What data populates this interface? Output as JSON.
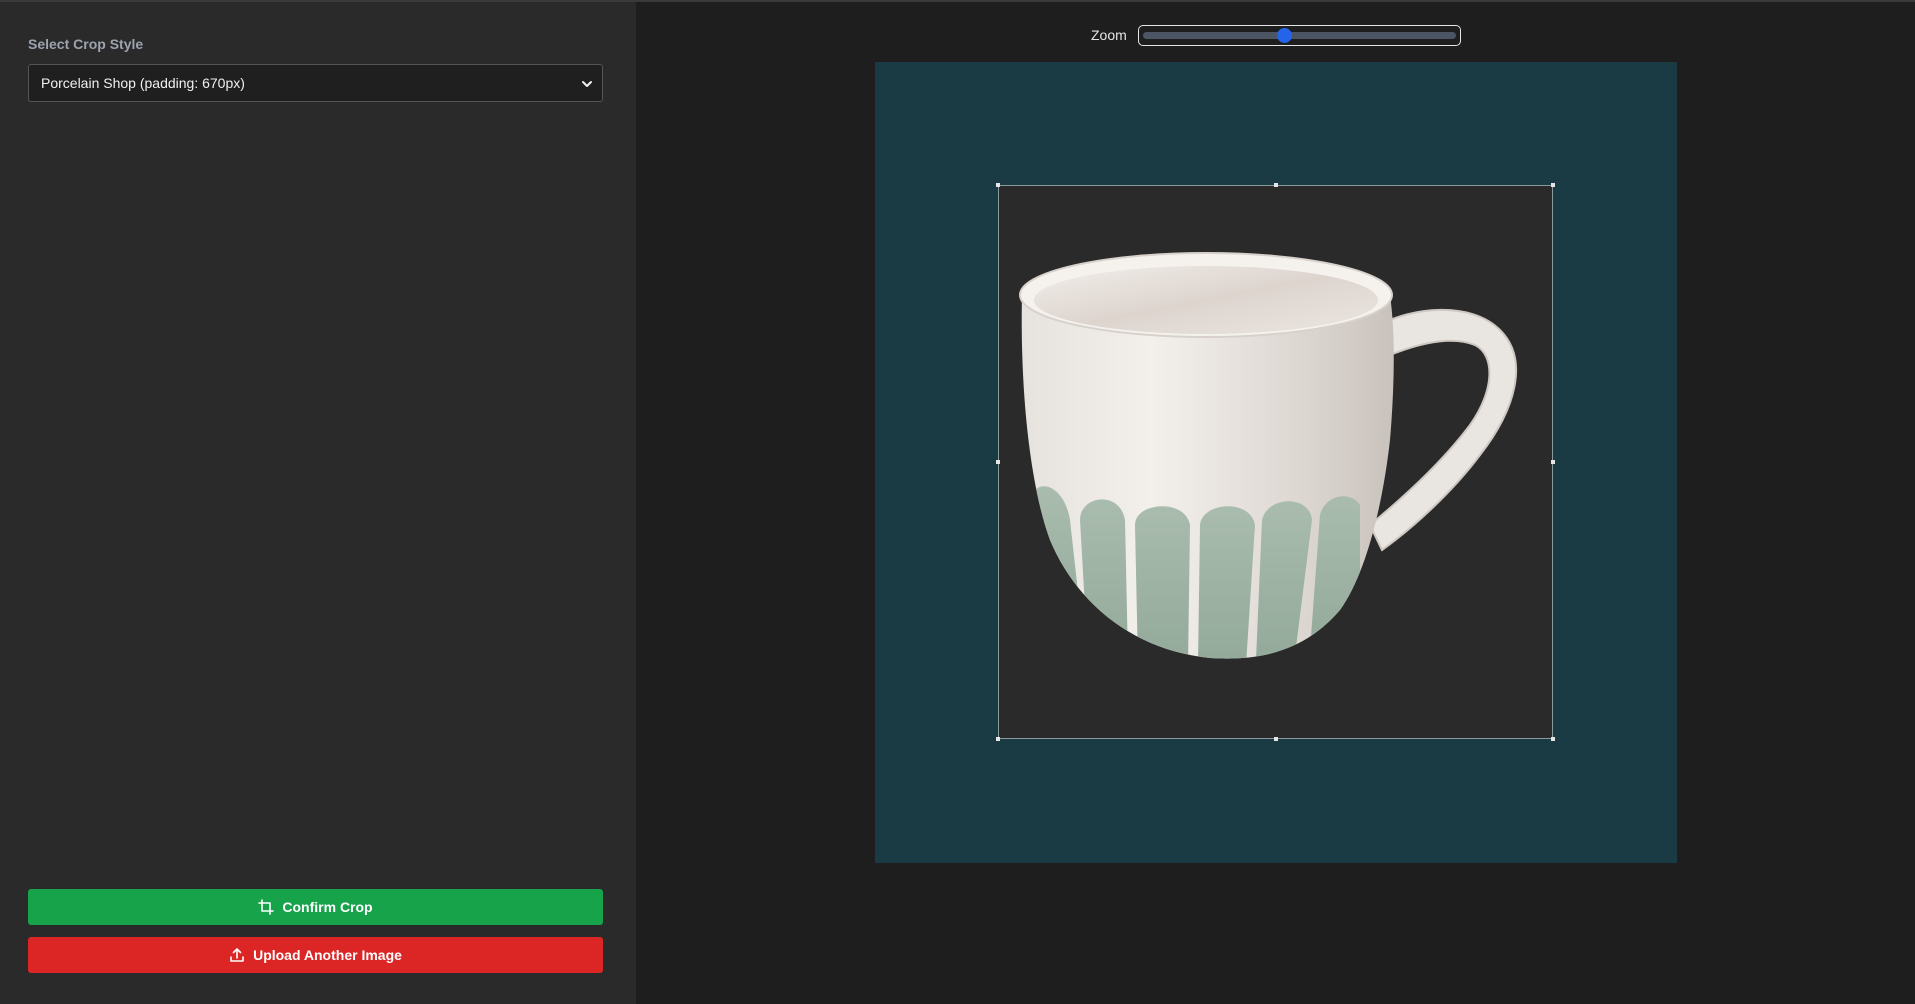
{
  "sidebar": {
    "crop_label": "Select Crop Style",
    "crop_select": {
      "selected": "Porcelain Shop (padding: 670px)",
      "icon": "chevron-down-icon"
    },
    "confirm_button": {
      "label": "Confirm Crop",
      "icon": "crop-icon",
      "color": "#16a34a"
    },
    "upload_button": {
      "label": "Upload Another Image",
      "icon": "upload-icon",
      "color": "#dc2626"
    }
  },
  "editor": {
    "zoom_label": "Zoom",
    "zoom_value": 0.45,
    "accent": "#2563eb",
    "canvas_background": "#1a3b44",
    "image_subject": "white ceramic mug with sage green petal pattern"
  }
}
